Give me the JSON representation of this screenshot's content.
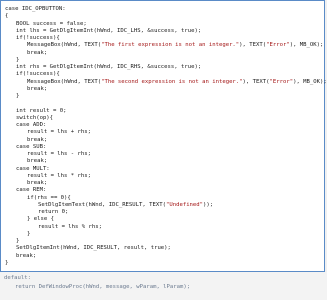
{
  "code": {
    "lines": [
      {
        "text": "case IDC_OPBUTTON:",
        "indent": 0
      },
      {
        "text": "{",
        "indent": 0
      },
      {
        "text": "BOOL success = false;",
        "indent": 1
      },
      {
        "text": "int lhs = GetDlgItemInt(hWnd, IDC_LHS, &success, true);",
        "indent": 1
      },
      {
        "text": "if(!success){",
        "indent": 1
      },
      {
        "text": "MessageBox(hWnd, TEXT(\"The first expression is not an integer.\"), TEXT(\"Error\"), MB_OK);",
        "indent": 2
      },
      {
        "text": "break;",
        "indent": 2
      },
      {
        "text": "}",
        "indent": 1
      },
      {
        "text": "int rhs = GetDlgItemInt(hWnd, IDC_RHS, &success, true);",
        "indent": 1
      },
      {
        "text": "if(!success){",
        "indent": 1
      },
      {
        "text": "MessageBox(hWnd, TEXT(\"The second expression is not an integer.\"), TEXT(\"Error\"), MB_OK);",
        "indent": 2
      },
      {
        "text": "break;",
        "indent": 2
      },
      {
        "text": "}",
        "indent": 1
      },
      {
        "text": "",
        "indent": 0
      },
      {
        "text": "int result = 0;",
        "indent": 1
      },
      {
        "text": "switch(op){",
        "indent": 1
      },
      {
        "text": "case ADD:",
        "indent": 1
      },
      {
        "text": "result = lhs + rhs;",
        "indent": 2
      },
      {
        "text": "break;",
        "indent": 2
      },
      {
        "text": "case SUB:",
        "indent": 1
      },
      {
        "text": "result = lhs - rhs;",
        "indent": 2
      },
      {
        "text": "break;",
        "indent": 2
      },
      {
        "text": "case MULT:",
        "indent": 1
      },
      {
        "text": "result = lhs * rhs;",
        "indent": 2
      },
      {
        "text": "break;",
        "indent": 2
      },
      {
        "text": "case REM:",
        "indent": 1
      },
      {
        "text": "if(rhs == 0){",
        "indent": 2
      },
      {
        "text": "SetDlgItemText(hWnd, IDC_RESULT, TEXT(\"Undefined\"));",
        "indent": 3
      },
      {
        "text": "return 0;",
        "indent": 3
      },
      {
        "text": "} else {",
        "indent": 2
      },
      {
        "text": "result = lhs % rhs;",
        "indent": 3
      },
      {
        "text": "}",
        "indent": 2
      },
      {
        "text": "}",
        "indent": 1
      },
      {
        "text": "SetDlgItemInt(hWnd, IDC_RESULT, result, true);",
        "indent": 1
      },
      {
        "text": "break;",
        "indent": 1
      },
      {
        "text": "}",
        "indent": 0
      }
    ]
  },
  "below": {
    "lines": [
      {
        "text": "default:",
        "indent": 0
      },
      {
        "text": "return DefWindowProc(hWnd, message, wParam, lParam);",
        "indent": 1
      }
    ]
  },
  "colors": {
    "border": "#5a8bc7",
    "string": "#a31515",
    "faded_text": "#6b7a8f"
  }
}
